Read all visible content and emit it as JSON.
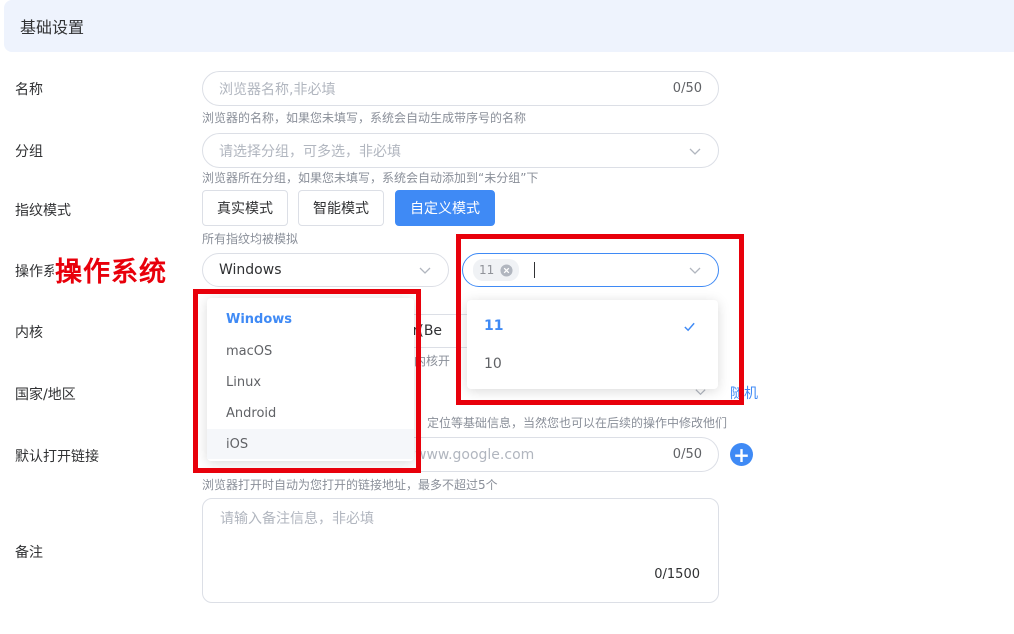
{
  "section": {
    "title": "基础设置"
  },
  "fields": {
    "name": {
      "label": "名称",
      "placeholder": "浏览器名称,非必填",
      "counter": "0/50",
      "hint": "浏览器的名称，如果您未填写，系统会自动生成带序号的名称"
    },
    "group": {
      "label": "分组",
      "placeholder": "请选择分组，可多选，非必填",
      "hint": "浏览器所在分组，如果您未填写，系统会自动添加到“未分组”下"
    },
    "fingerprint": {
      "label": "指纹模式",
      "buttons": [
        "真实模式",
        "智能模式",
        "自定义模式"
      ],
      "selected": "自定义模式",
      "hint": "所有指纹均被模拟"
    },
    "os": {
      "label": "操作系",
      "selected": "Windows",
      "version_tag": "11"
    },
    "kernel": {
      "label": "内核",
      "value_partial": "er(Be",
      "hint_partial": "内核开"
    },
    "country": {
      "label": "国家/地区",
      "random_link": "随机",
      "hint_partial": "定位等基础信息，当然您也可以在后续的操作中修改他们"
    },
    "default_url": {
      "label": "默认打开链接",
      "placeholder_partial": "www.google.com",
      "counter": "0/50",
      "hint": "浏览器打开时自动为您打开的链接地址，最多不超过5个"
    },
    "notes": {
      "label": "备注",
      "placeholder": "请输入备注信息，非必填",
      "counter": "0/1500"
    }
  },
  "os_dropdown": {
    "options": [
      "Windows",
      "macOS",
      "Linux",
      "Android",
      "iOS"
    ],
    "selected": "Windows",
    "hovered": "iOS"
  },
  "version_dropdown": {
    "options": [
      "11",
      "10"
    ],
    "selected": "11"
  },
  "annotation": {
    "text": "操作系统"
  },
  "colors": {
    "accent": "#3f8af5",
    "header_bg": "#eef3fd",
    "annotation": "#e8000b"
  },
  "icons": {
    "chevron": "chevron-down-icon",
    "check": "check-icon",
    "tag_close": "close-circle-icon",
    "add": "plus-circle-icon"
  }
}
